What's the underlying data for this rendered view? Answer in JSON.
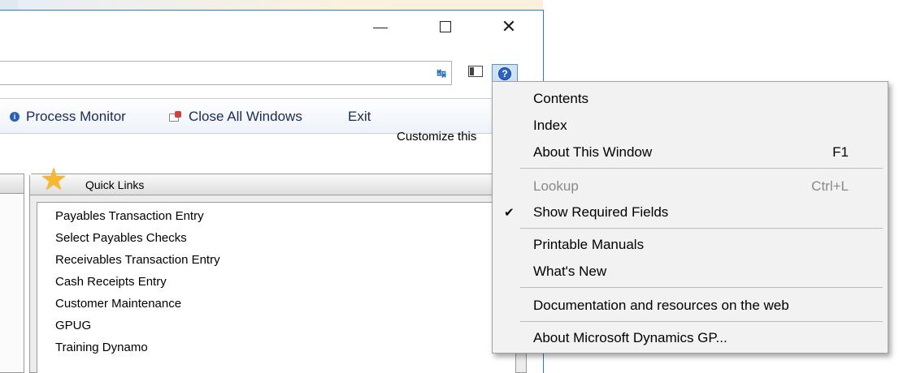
{
  "toolbar": {
    "process_monitor": "Process Monitor",
    "close_all_windows": "Close All Windows",
    "exit": "Exit"
  },
  "page": {
    "customize": "Customize this"
  },
  "quick_links": {
    "title": "Quick Links",
    "items": [
      "Payables Transaction Entry",
      "Select Payables Checks",
      "Receivables Transaction Entry",
      "Cash Receipts Entry",
      "Customer Maintenance",
      "GPUG",
      "Training Dynamo"
    ]
  },
  "menu": {
    "contents": "Contents",
    "index": "Index",
    "about_window": "About This Window",
    "about_window_shortcut": "F1",
    "lookup": "Lookup",
    "lookup_shortcut": "Ctrl+L",
    "show_required": "Show Required Fields",
    "show_required_checked": true,
    "printable_manuals": "Printable Manuals",
    "whats_new": "What's New",
    "documentation": "Documentation and resources on the web",
    "about_gp": "About Microsoft Dynamics GP..."
  },
  "icons": {
    "goto": "refresh-arrows-icon",
    "pane": "pane-layout-icon",
    "help": "help-icon",
    "star": "star-icon",
    "process_monitor": "info-icon",
    "close_all_windows": "close-windows-icon"
  },
  "colors": {
    "accent": "#2a7bd0",
    "toolbar_text": "#1b2a55",
    "star": "#f7b731",
    "menu_bg": "#f2f2f2",
    "disabled_text": "#8a8a8a"
  }
}
